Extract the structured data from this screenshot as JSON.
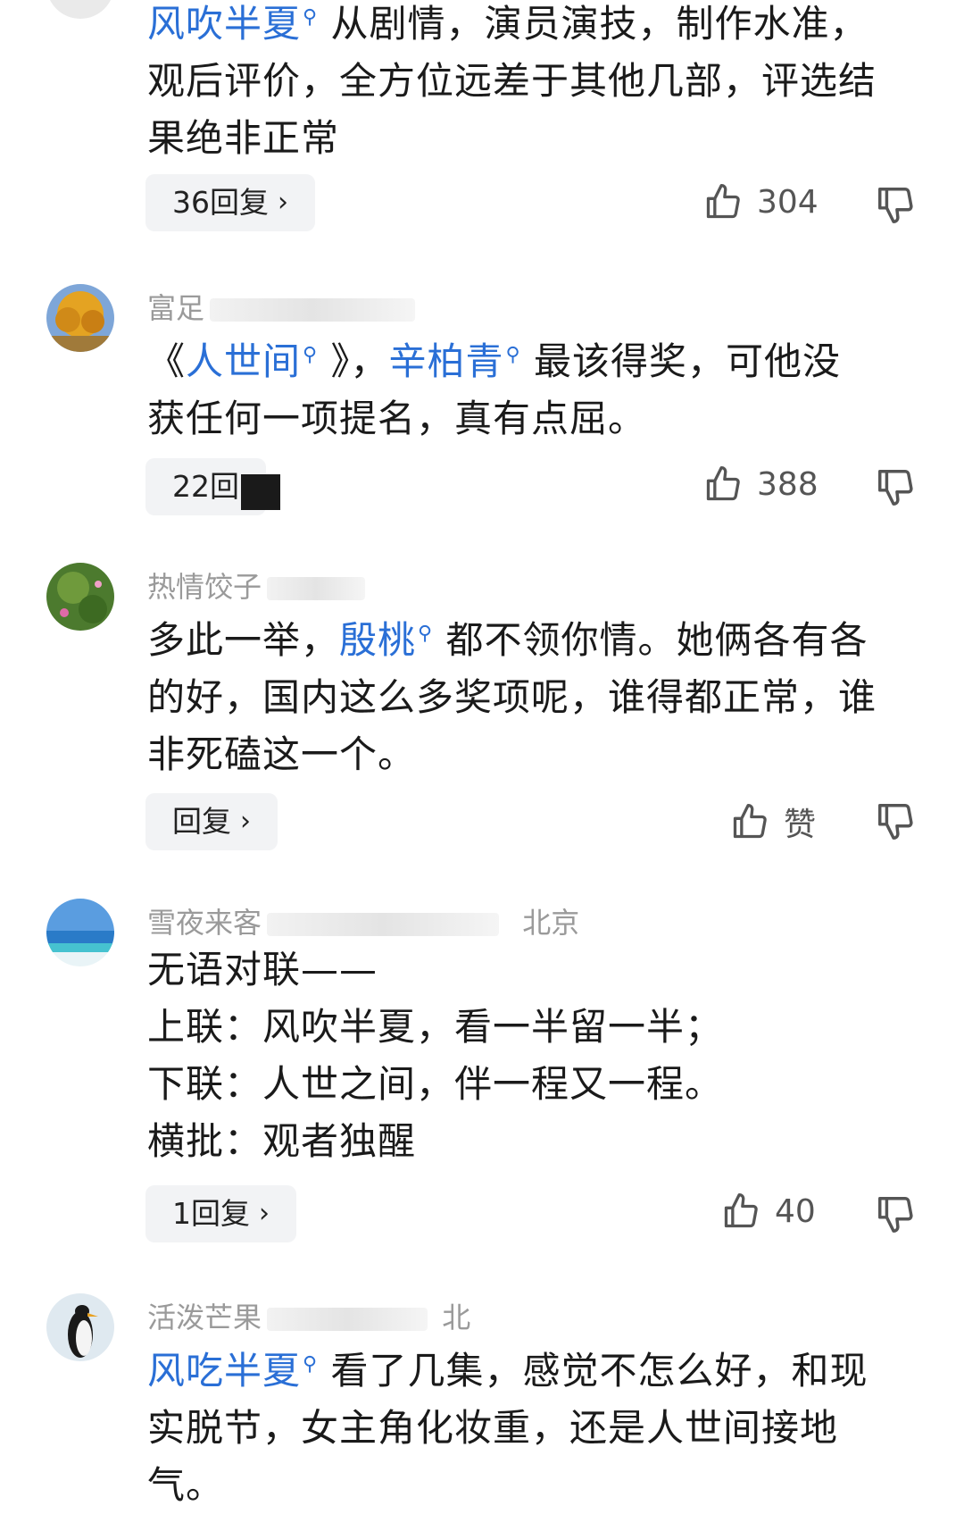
{
  "comments": [
    {
      "user": "",
      "segments_line1": [
        {
          "t": "风吹半夏",
          "tag": true
        },
        {
          "t": " 从剧情，演员演技，制作水准，",
          "tag": false
        }
      ],
      "line2": "观后评价，全方位远差于其他几部，评选结",
      "line3": "果绝非正常",
      "reply_label": "36回复",
      "likes": "304"
    },
    {
      "user": "富足",
      "segments_line1": [
        {
          "t": "《",
          "tag": false
        },
        {
          "t": "人世间",
          "tag": true
        },
        {
          "t": " 》，",
          "tag": false
        },
        {
          "t": "辛柏青",
          "tag": true
        },
        {
          "t": " 最该得奖，可他没",
          "tag": false
        }
      ],
      "line2": "获任何一项提名，真有点屈。",
      "reply_label": "22回",
      "likes": "388"
    },
    {
      "user": "热情饺子",
      "segments_line1": [
        {
          "t": "多此一举，",
          "tag": false
        },
        {
          "t": "殷桃",
          "tag": true
        },
        {
          "t": " 都不领你情。她俩各有各",
          "tag": false
        }
      ],
      "line2": "的好，国内这么多奖项呢，谁得都正常，谁",
      "line3": "非死磕这一个。",
      "reply_label": "回复",
      "likes": "赞"
    },
    {
      "user": "雪夜来客",
      "location": "北京",
      "line1": "无语对联——",
      "line2": "上联：风吹半夏，看一半留一半；",
      "line3": "下联：人世之间，伴一程又一程。",
      "line4": "横批：观者独醒",
      "reply_label": "1回复",
      "likes": "40"
    },
    {
      "user": "活泼芒果",
      "location": "北",
      "segments_line1": [
        {
          "t": "风吃半夏",
          "tag": true
        },
        {
          "t": " 看了几集，感觉不怎么好，和现",
          "tag": false
        }
      ],
      "line2": "实脱节，女主角化妆重，还是人世间接地",
      "line3": "气。"
    }
  ],
  "icons": {
    "like": "thumbs-up-icon",
    "dislike": "thumbs-down-icon",
    "search_tag": "magnifier-icon",
    "chevron": "chevron-right-icon"
  },
  "colors": {
    "tag_blue": "#2a6fd6",
    "username_gray": "#9a9a9a",
    "reply_bg": "#f2f3f5"
  }
}
